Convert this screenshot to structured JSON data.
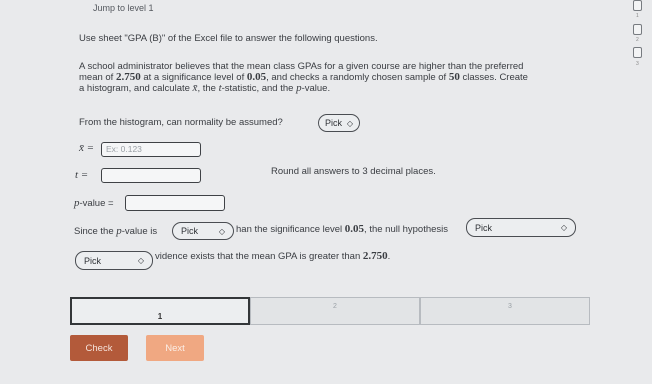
{
  "nav": {
    "jump_link": "Jump to level 1"
  },
  "instructions": {
    "sheet": "Use sheet \"GPA (B)\" of the Excel file to answer the following questions."
  },
  "problem": {
    "line1": "A school administrator believes that the mean class GPAs for a given course are higher than the preferred",
    "line2_a": "mean of ",
    "mean_value": "2.750",
    "line2_b": " at a significance level of ",
    "alpha": "0.05",
    "line2_c": ", and checks a randomly chosen sample of ",
    "sample_size": "50",
    "line2_d": " classes. Create",
    "line3_a": "a histogram, and calculate ",
    "xbar_symbol": "x̄",
    "line3_b": ", the ",
    "t_symbol": "t",
    "line3_c": "-statistic, and the ",
    "p_symbol": "p",
    "line3_d": "-value."
  },
  "normality": {
    "question": "From the histogram, can normality be assumed?",
    "pick_label": "Pick"
  },
  "fields": {
    "xbar_label": "x̄ =",
    "xbar_placeholder": "Ex: 0.123",
    "xbar_value": "",
    "t_label": "t =",
    "t_value": "",
    "round_note": "Round all answers to 3 decimal places.",
    "p_label_sym": "p",
    "p_label_rest": "-value =",
    "p_value": ""
  },
  "conclusion": {
    "since_a": "Since the ",
    "p_sym": "p",
    "since_b": "-value is",
    "pick1_label": "Pick",
    "than_a": "han the significance level ",
    "alpha": "0.05",
    "than_b": ", the null hypothesis",
    "pick2_label": "Pick",
    "pick3_label": "Pick",
    "evidence_a": "vidence exists that the mean GPA is greater than ",
    "mean_value": "2.750",
    "evidence_b": "."
  },
  "levels": [
    {
      "label": "1"
    },
    {
      "label": "2"
    },
    {
      "label": "3"
    }
  ],
  "buttons": {
    "check": "Check",
    "next": "Next"
  },
  "colors": {
    "check_bg": "#b35a3a",
    "next_bg": "#f0a882",
    "page_bg": "#e9eaec"
  },
  "sidebar": {
    "icon1_num": "1",
    "icon2_num": "2",
    "icon3_num": "3"
  }
}
